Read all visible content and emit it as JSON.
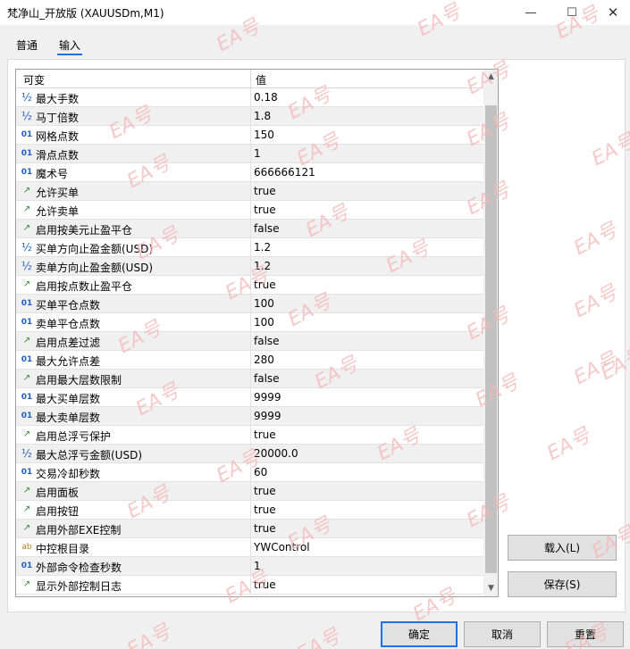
{
  "window": {
    "title": "梵净山_开放版 (XAUUSDm,M1)",
    "min_glyph": "—",
    "max_glyph": "☐",
    "close_glyph": "✕"
  },
  "tabs": [
    {
      "label": "普通",
      "active": false
    },
    {
      "label": "输入",
      "active": true
    }
  ],
  "grid": {
    "col_variable": "可变",
    "col_value": "值",
    "rows": [
      {
        "type": "half",
        "icon": "½",
        "name": "最大手数",
        "value": "0.18"
      },
      {
        "type": "half",
        "icon": "½",
        "name": "马丁倍数",
        "value": "1.8"
      },
      {
        "type": "num",
        "icon": "01",
        "name": "网格点数",
        "value": "150"
      },
      {
        "type": "num",
        "icon": "01",
        "name": "滑点点数",
        "value": "1"
      },
      {
        "type": "num",
        "icon": "01",
        "name": "魔术号",
        "value": "666666121"
      },
      {
        "type": "bool",
        "icon": "↗",
        "name": "允许买单",
        "value": "true"
      },
      {
        "type": "bool",
        "icon": "↗",
        "name": "允许卖单",
        "value": "true"
      },
      {
        "type": "bool",
        "icon": "↗",
        "name": "启用按美元止盈平仓",
        "value": "false"
      },
      {
        "type": "half",
        "icon": "½",
        "name": "买单方向止盈金额(USD)",
        "value": "1.2"
      },
      {
        "type": "half",
        "icon": "½",
        "name": "卖单方向止盈金额(USD)",
        "value": "1.2"
      },
      {
        "type": "bool",
        "icon": "↗",
        "name": "启用按点数止盈平仓",
        "value": "true"
      },
      {
        "type": "num",
        "icon": "01",
        "name": "买单平仓点数",
        "value": "100"
      },
      {
        "type": "num",
        "icon": "01",
        "name": "卖单平仓点数",
        "value": "100"
      },
      {
        "type": "bool",
        "icon": "↗",
        "name": "启用点差过滤",
        "value": "false"
      },
      {
        "type": "num",
        "icon": "01",
        "name": "最大允许点差",
        "value": "280"
      },
      {
        "type": "bool",
        "icon": "↗",
        "name": "启用最大层数限制",
        "value": "false"
      },
      {
        "type": "num",
        "icon": "01",
        "name": "最大买单层数",
        "value": "9999"
      },
      {
        "type": "num",
        "icon": "01",
        "name": "最大卖单层数",
        "value": "9999"
      },
      {
        "type": "bool",
        "icon": "↗",
        "name": "启用总浮亏保护",
        "value": "true"
      },
      {
        "type": "half",
        "icon": "½",
        "name": "最大总浮亏金额(USD)",
        "value": "20000.0"
      },
      {
        "type": "num",
        "icon": "01",
        "name": "交易冷却秒数",
        "value": "60"
      },
      {
        "type": "bool",
        "icon": "↗",
        "name": "启用面板",
        "value": "true"
      },
      {
        "type": "bool",
        "icon": "↗",
        "name": "启用按钮",
        "value": "true"
      },
      {
        "type": "bool",
        "icon": "↗",
        "name": "启用外部EXE控制",
        "value": "true"
      },
      {
        "type": "str",
        "icon": "ab",
        "name": "中控根目录",
        "value": "YWControl"
      },
      {
        "type": "num",
        "icon": "01",
        "name": "外部命令检查秒数",
        "value": "1"
      },
      {
        "type": "bool",
        "icon": "↗",
        "name": "显示外部控制日志",
        "value": "true"
      }
    ]
  },
  "buttons": {
    "load": "载入(L)",
    "save": "保存(S)",
    "ok": "确定",
    "cancel": "取消",
    "reset": "重置"
  },
  "watermark": "EA号",
  "colors": {
    "accent": "#1a73e8",
    "watermark": "#f4b7b7"
  }
}
